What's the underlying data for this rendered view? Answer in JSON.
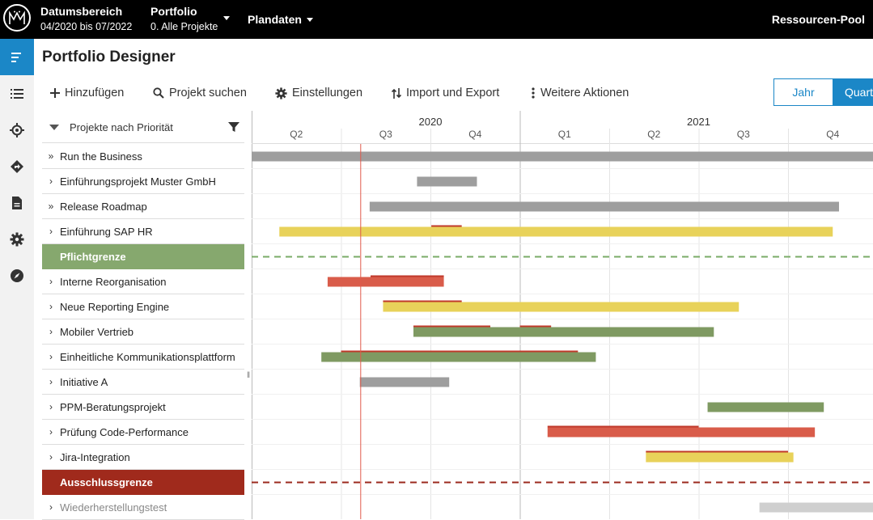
{
  "topbar": {
    "datumsbereich_label": "Datumsbereich",
    "datumsbereich_value": "04/2020 bis 07/2022",
    "portfolio_label": "Portfolio",
    "portfolio_value": "0. Alle Projekte",
    "plandaten_label": "Plandaten",
    "ressourcen_label": "Ressourcen-Pool"
  },
  "nav": {
    "items": [
      "menu-icon",
      "list-icon",
      "target-icon",
      "route-icon",
      "document-icon",
      "gear-icon",
      "compass-icon"
    ]
  },
  "page": {
    "title": "Portfolio Designer"
  },
  "toolbar": {
    "add": "Hinzufügen",
    "search": "Projekt suchen",
    "settings": "Einstellungen",
    "import_export": "Import und Export",
    "more": "Weitere Aktionen",
    "view_year": "Jahr",
    "view_quarter": "Quartal",
    "active_view": "Quartal"
  },
  "list": {
    "header": "Projekte nach Priorität",
    "rows": [
      {
        "label": "Run the Business",
        "chevron": "»",
        "type": "project"
      },
      {
        "label": "Einführungsprojekt Muster GmbH",
        "chevron": "›",
        "type": "project"
      },
      {
        "label": "Release Roadmap",
        "chevron": "»",
        "type": "project"
      },
      {
        "label": "Einführung SAP HR",
        "chevron": "›",
        "type": "project"
      },
      {
        "label": "Pflichtgrenze",
        "chevron": "",
        "type": "pflicht"
      },
      {
        "label": "Interne Reorganisation",
        "chevron": "›",
        "type": "project"
      },
      {
        "label": "Neue Reporting Engine",
        "chevron": "›",
        "type": "project"
      },
      {
        "label": "Mobiler Vertrieb",
        "chevron": "›",
        "type": "project"
      },
      {
        "label": "Einheitliche Kommunikationsplattform",
        "chevron": "›",
        "type": "project"
      },
      {
        "label": "Initiative A",
        "chevron": "›",
        "type": "project"
      },
      {
        "label": "PPM-Beratungsprojekt",
        "chevron": "›",
        "type": "project"
      },
      {
        "label": "Prüfung Code-Performance",
        "chevron": "›",
        "type": "project"
      },
      {
        "label": "Jira-Integration",
        "chevron": "›",
        "type": "project"
      },
      {
        "label": "Ausschlussgrenze",
        "chevron": "",
        "type": "aus"
      },
      {
        "label": "Wiederherstellungstest",
        "chevron": "›",
        "type": "muted"
      }
    ]
  },
  "timeline": {
    "years": [
      {
        "label": "2020",
        "quarter_index": 2
      },
      {
        "label": "2021",
        "quarter_index": 5
      }
    ],
    "quarters": [
      "Q2",
      "Q3",
      "Q4",
      "Q1",
      "Q2",
      "Q3",
      "Q4"
    ],
    "year_boundaries_q": [
      3
    ],
    "today_q": 1.22,
    "colors": {
      "gray": "#9e9e9e",
      "lightgray": "#cfcfcf",
      "yellow": "#e8d25a",
      "red": "#d95c4a",
      "green": "#7f9a62",
      "accent_red": "#c0392b",
      "pflicht_line": "#7aab67",
      "aus_line": "#9b2a1e",
      "today_line": "#e05a4a"
    },
    "bars": [
      {
        "row": 0,
        "start": 0.0,
        "end": 7.0,
        "color": "gray"
      },
      {
        "row": 1,
        "start": 1.85,
        "end": 2.52,
        "color": "gray"
      },
      {
        "row": 2,
        "start": 1.32,
        "end": 6.57,
        "color": "gray"
      },
      {
        "row": 3,
        "start": 0.31,
        "end": 6.5,
        "color": "yellow",
        "marks": [
          [
            2.01,
            2.35
          ]
        ]
      },
      {
        "row": 5,
        "start": 0.85,
        "end": 2.15,
        "color": "red",
        "marks": [
          [
            1.33,
            2.15
          ]
        ]
      },
      {
        "row": 6,
        "start": 1.47,
        "end": 5.45,
        "color": "yellow",
        "marks": [
          [
            1.47,
            2.35
          ]
        ]
      },
      {
        "row": 7,
        "start": 1.81,
        "end": 5.17,
        "color": "green",
        "marks": [
          [
            1.81,
            2.67
          ],
          [
            3.0,
            3.35
          ]
        ]
      },
      {
        "row": 8,
        "start": 0.78,
        "end": 3.85,
        "color": "green",
        "marks": [
          [
            1.0,
            3.65
          ]
        ]
      },
      {
        "row": 9,
        "start": 1.21,
        "end": 2.21,
        "color": "gray"
      },
      {
        "row": 10,
        "start": 5.1,
        "end": 6.4,
        "color": "green"
      },
      {
        "row": 11,
        "start": 3.31,
        "end": 6.3,
        "color": "red",
        "marks": [
          [
            3.31,
            5.0
          ]
        ]
      },
      {
        "row": 12,
        "start": 4.41,
        "end": 6.06,
        "color": "yellow",
        "marks": [
          [
            4.41,
            6.0
          ]
        ]
      },
      {
        "row": 14,
        "start": 5.68,
        "end": 7.0,
        "color": "lightgray"
      }
    ],
    "limits": [
      {
        "row": 4,
        "color": "pflicht_line"
      },
      {
        "row": 13,
        "color": "aus_line"
      }
    ]
  }
}
